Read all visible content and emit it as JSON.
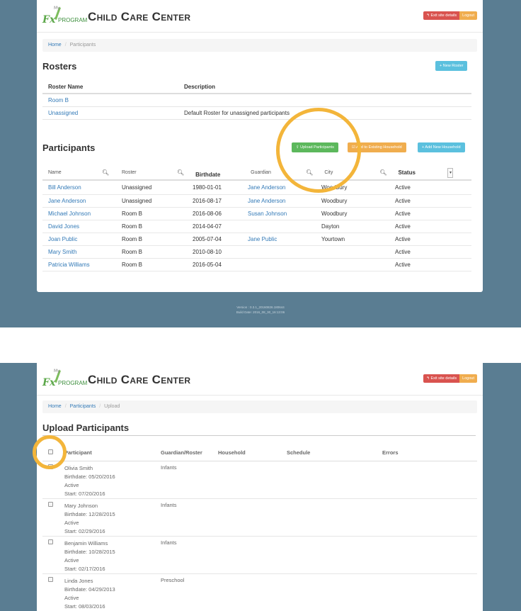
{
  "app": {
    "title": "Child Care Center",
    "logo_my": "My",
    "logo_fx": "Fx",
    "logo_program": "PROGRAM"
  },
  "header": {
    "exit_label": "↰ Exit site details",
    "logout_label": "Logout"
  },
  "screen1": {
    "breadcrumb": {
      "home": "Home",
      "current": "Participants"
    },
    "rosters": {
      "title": "Rosters",
      "new_button": "+ New Roster",
      "columns": [
        "Roster Name",
        "Description"
      ],
      "rows": [
        {
          "name": "Room B",
          "description": ""
        },
        {
          "name": "Unassigned",
          "description": "Default Roster for unassigned participants"
        }
      ]
    },
    "participants": {
      "title": "Participants",
      "buttons": {
        "upload": "⇪ Upload Participants",
        "add_existing": "☑ Add to Existing Household",
        "add_new": "+ Add New Household"
      },
      "columns": {
        "name": "Name",
        "roster": "Roster",
        "birthdate": "Birthdate",
        "guardian": "Guardian",
        "city": "City",
        "status": "Status"
      },
      "rows": [
        {
          "name": "Bill Anderson",
          "roster": "Unassigned",
          "birthdate": "1980-01-01",
          "guardian": "Jane Anderson",
          "city": "Woodbury",
          "status": "Active"
        },
        {
          "name": "Jane Anderson",
          "roster": "Unassigned",
          "birthdate": "2016-08-17",
          "guardian": "Jane Anderson",
          "city": "Woodbury",
          "status": "Active"
        },
        {
          "name": "Michael Johnson",
          "roster": "Room B",
          "birthdate": "2016-08-06",
          "guardian": "Susan Johnson",
          "city": "Woodbury",
          "status": "Active"
        },
        {
          "name": "David Jones",
          "roster": "Room B",
          "birthdate": "2014-04-07",
          "guardian": "",
          "city": "Dayton",
          "status": "Active"
        },
        {
          "name": "Joan Public",
          "roster": "Room B",
          "birthdate": "2005-07-04",
          "guardian": "Jane Public",
          "city": "Yourtown",
          "status": "Active"
        },
        {
          "name": "Mary Smith",
          "roster": "Room B",
          "birthdate": "2010-08-10",
          "guardian": "",
          "city": "",
          "status": "Active"
        },
        {
          "name": "Patricia Williams",
          "roster": "Room B",
          "birthdate": "2016-05-04",
          "guardian": "",
          "city": "",
          "status": "Active"
        }
      ]
    },
    "version": {
      "line1": "Version : 0.3.1_20160826.180644",
      "line2": "Build Date: 2016_08_30_16:13:06"
    }
  },
  "screen2": {
    "breadcrumb": {
      "home": "Home",
      "participants": "Participants",
      "current": "Upload"
    },
    "title": "Upload Participants",
    "columns": {
      "participant": "Participant",
      "guardian": "Guardian/Roster",
      "household": "Household",
      "schedule": "Schedule",
      "errors": "Errors"
    },
    "rows": [
      {
        "name": "Olivia Smith",
        "birthdate": "Birthdate: 05/20/2016",
        "status": "Active",
        "start": "Start: 07/20/2016",
        "roster": "Infants"
      },
      {
        "name": "Mary Johnson",
        "birthdate": "Birthdate: 12/28/2015",
        "status": "Active",
        "start": "Start: 02/29/2016",
        "roster": "Infants"
      },
      {
        "name": "Benjamin Williams",
        "birthdate": "Birthdate: 10/28/2015",
        "status": "Active",
        "start": "Start: 02/17/2016",
        "roster": "Infants"
      },
      {
        "name": "Linda Jones",
        "birthdate": "Birthdate: 04/29/2013",
        "status": "Active",
        "start": "Start: 08/03/2016",
        "roster": "Preschool"
      }
    ]
  },
  "colors": {
    "background": "#5a7d92",
    "highlight": "#f3b53a",
    "link": "#337ab7",
    "success": "#5cb85c",
    "warning": "#f0ad4e",
    "info": "#5bc0de",
    "danger": "#d9534f"
  }
}
